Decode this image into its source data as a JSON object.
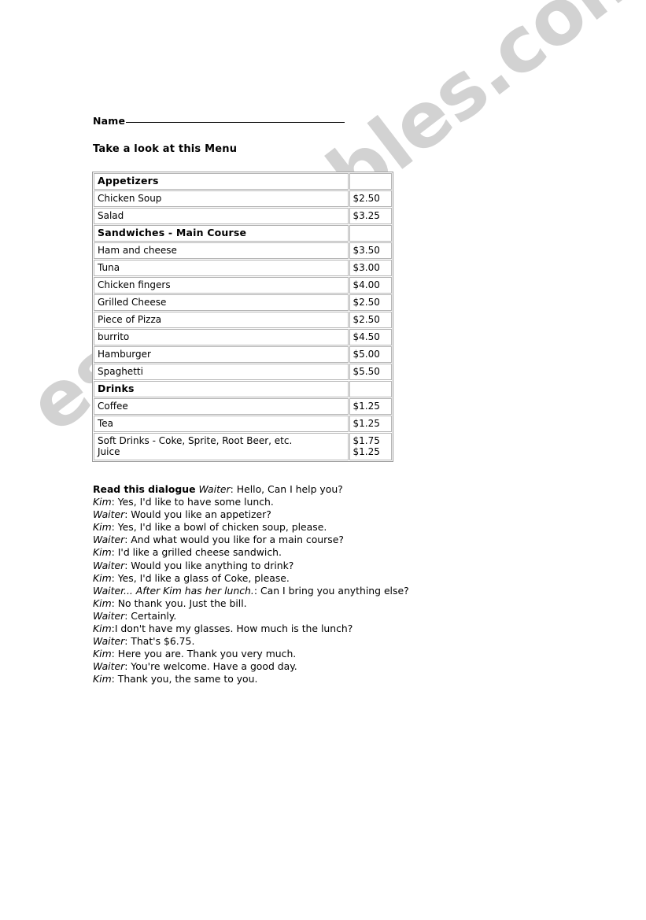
{
  "worksheet": {
    "name_field": {
      "label": "Name",
      "rule": ""
    },
    "instruction": "Take a look at this Menu"
  },
  "menu": {
    "rows": [
      {
        "type": "section",
        "item": "Appetizers",
        "price": ""
      },
      {
        "type": "item",
        "item": "Chicken Soup",
        "price": "$2.50"
      },
      {
        "type": "item",
        "item": "Salad",
        "price": "$3.25"
      },
      {
        "type": "section",
        "item": "Sandwiches - Main Course",
        "price": ""
      },
      {
        "type": "item",
        "item": "Ham and cheese",
        "price": "$3.50"
      },
      {
        "type": "item",
        "item": "Tuna",
        "price": "$3.00"
      },
      {
        "type": "item",
        "item": "Chicken fingers",
        "price": "$4.00"
      },
      {
        "type": "item",
        "item": "Grilled Cheese",
        "price": "$2.50"
      },
      {
        "type": "item",
        "item": "Piece of Pizza",
        "price": "$2.50"
      },
      {
        "type": "item",
        "item": "burrito",
        "price": "$4.50"
      },
      {
        "type": "item",
        "item": "Hamburger",
        "price": "$5.00"
      },
      {
        "type": "item",
        "item": "Spaghetti",
        "price": "$5.50"
      },
      {
        "type": "section",
        "item": "Drinks",
        "price": ""
      },
      {
        "type": "item",
        "item": "Coffee",
        "price": "$1.25"
      },
      {
        "type": "item",
        "item": "Tea",
        "price": "$1.25"
      },
      {
        "type": "item",
        "item": "Soft Drinks - Coke, Sprite, Root Beer, etc.\nJuice",
        "price": "$1.75\n$1.25"
      }
    ]
  },
  "dialogue": {
    "heading": "Read this dialogue",
    "lines": [
      {
        "speaker": "Waiter",
        "separator": ": ",
        "text": "Hello, Can I help you?"
      },
      {
        "speaker": "Kim",
        "separator": ": ",
        "text": "Yes, I'd like to have some lunch."
      },
      {
        "speaker": "Waiter",
        "separator": ": ",
        "text": "Would you like an appetizer?"
      },
      {
        "speaker": "Kim",
        "separator": ": ",
        "text": "Yes, I'd like a bowl of chicken soup, please."
      },
      {
        "speaker": "Waiter",
        "separator": ": ",
        "text": "And what would you like for a main course?"
      },
      {
        "speaker": "Kim",
        "separator": ": ",
        "text": "I'd like a grilled cheese sandwich."
      },
      {
        "speaker": "Waiter",
        "separator": ": ",
        "text": "Would you like anything to drink?"
      },
      {
        "speaker": "Kim",
        "separator": ": ",
        "text": "Yes, I'd like a glass of Coke, please."
      },
      {
        "speaker": "Waiter... After Kim has her lunch.",
        "separator": ": ",
        "text": "Can I bring you anything else?"
      },
      {
        "speaker": "Kim",
        "separator": ": ",
        "text": "No thank you. Just the bill."
      },
      {
        "speaker": "Waiter",
        "separator": ": ",
        "text": "Certainly."
      },
      {
        "speaker": "Kim",
        "separator": ":",
        "text": "I don't have my glasses. How much is the lunch?"
      },
      {
        "speaker": "Waiter",
        "separator": ": ",
        "text": "That's $6.75."
      },
      {
        "speaker": "Kim",
        "separator": ": ",
        "text": "Here you are. Thank you very much."
      },
      {
        "speaker": "Waiter",
        "separator": ": ",
        "text": "You're welcome. Have a good day."
      },
      {
        "speaker": "Kim",
        "separator": ": ",
        "text": "Thank you, the same to you."
      }
    ]
  },
  "watermark": {
    "text": "eslprintables.com",
    "color": "#d2d2d2"
  }
}
